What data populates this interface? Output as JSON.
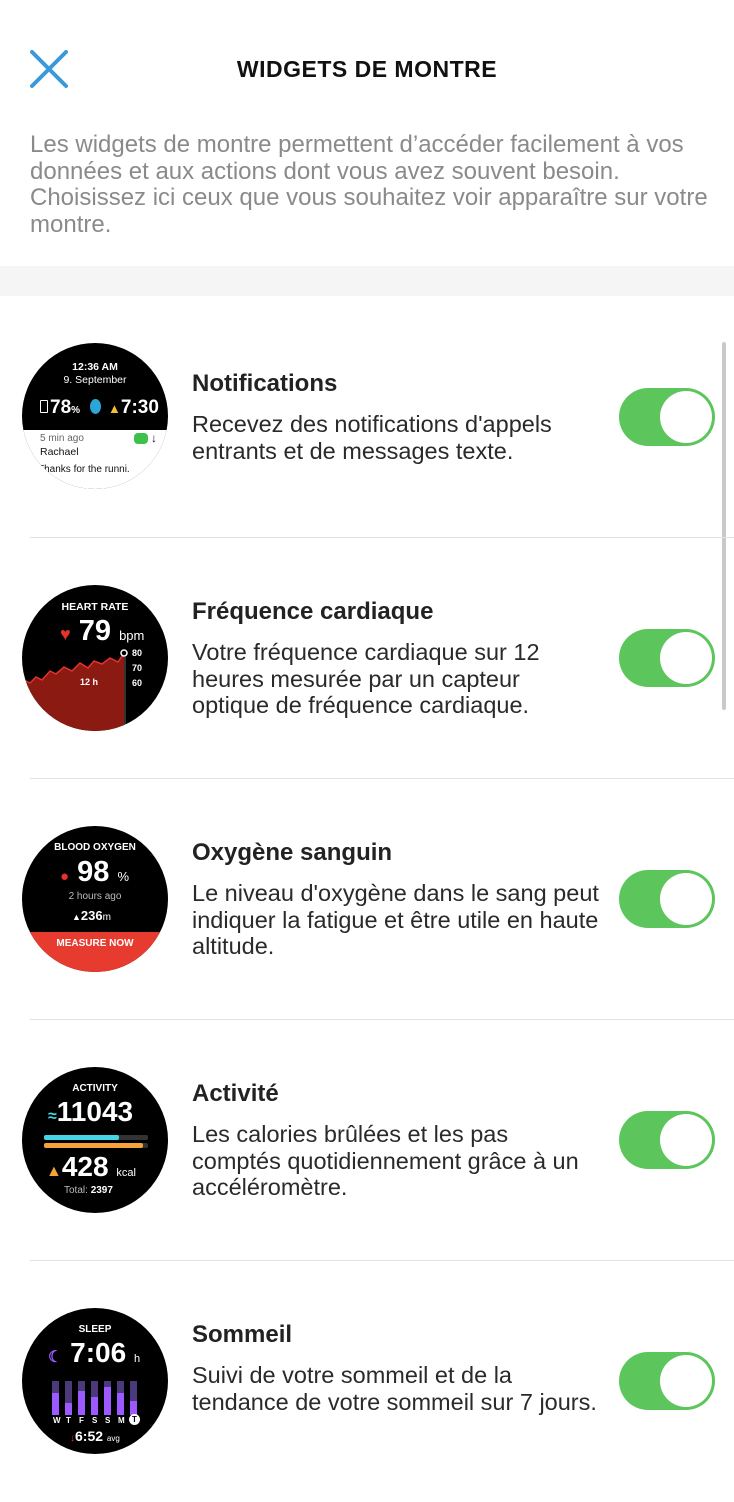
{
  "header": {
    "title": "WIDGETS DE MONTRE",
    "close_icon": "close-icon",
    "description": "Les widgets de montre permettent d’accéder facilement à vos données et aux actions dont vous avez souvent besoin. Choisissez ici ceux que vous souhaitez voir apparaître sur votre montre."
  },
  "colors": {
    "accent": "#3a9ad9",
    "toggle_on": "#5cc65c",
    "measure": "#e63b2e"
  },
  "widgets": [
    {
      "title": "Notifications",
      "description": "Recevez des notifications d'appels entrants et de messages texte.",
      "enabled": true,
      "preview": {
        "time": "12:36 AM",
        "date": "9. September",
        "battery": "78",
        "battery_unit": "%",
        "alarm": "7:30",
        "ago": "5 min ago",
        "sender": "Rachael",
        "message": "Thanks for the runni."
      }
    },
    {
      "title": "Fréquence cardiaque",
      "description": "Votre fréquence cardiaque sur 12 heures mesurée par un capteur optique de fréquence cardiaque.",
      "enabled": true,
      "preview": {
        "label": "HEART RATE",
        "value": "79",
        "unit": "bpm",
        "axis": [
          "80",
          "70",
          "60"
        ],
        "period": "12 h"
      }
    },
    {
      "title": "Oxygène sanguin",
      "description": "Le niveau d'oxygène dans le sang peut indiquer la fatigue et être utile en haute altitude.",
      "enabled": true,
      "preview": {
        "label": "BLOOD OXYGEN",
        "value": "98",
        "unit": "%",
        "ago": "2 hours ago",
        "altitude": "236",
        "altitude_unit": "m",
        "button": "MEASURE NOW"
      }
    },
    {
      "title": "Activité",
      "description": "Les calories brûlées et les pas comptés quotidiennement grâce à un accéléromètre.",
      "enabled": true,
      "preview": {
        "label": "ACTIVITY",
        "steps": "11043",
        "kcal": "428",
        "kcal_unit": "kcal",
        "total_label": "Total:",
        "total": "2397",
        "steps_progress": 0.72,
        "kcal_progress": 0.95
      }
    },
    {
      "title": "Sommeil",
      "description": "Suivi de votre sommeil et de la tendance de votre sommeil sur 7 jours.",
      "enabled": true,
      "preview": {
        "label": "SLEEP",
        "duration": "7:06",
        "unit": "h",
        "days": [
          "W",
          "T",
          "F",
          "S",
          "S",
          "M",
          "T"
        ],
        "avg": "6:52",
        "avg_unit": "avg"
      }
    }
  ]
}
